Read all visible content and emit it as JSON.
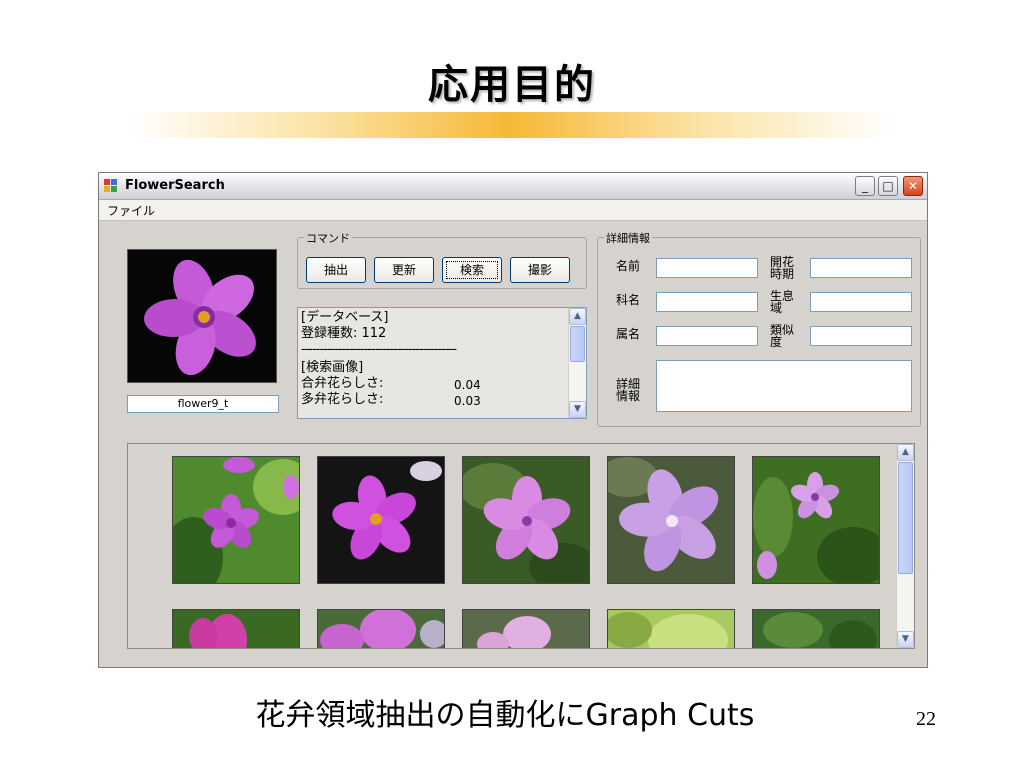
{
  "slide": {
    "title": "応用目的",
    "caption": "花弁領域抽出の自動化にGraph Cuts",
    "page_number": "22"
  },
  "window": {
    "title": "FlowerSearch",
    "menu": {
      "file": "ファイル"
    },
    "buttons": {
      "minimize": "_",
      "maximize": "□",
      "close": "✕"
    }
  },
  "query": {
    "image_label": "flower9_t",
    "image_icon": "flower-image"
  },
  "command": {
    "legend": "コマンド",
    "buttons": {
      "extract": "抽出",
      "update": "更新",
      "search": "検索",
      "capture": "撮影"
    }
  },
  "log": {
    "db_header": "[データベース]",
    "registered": "登録種数: 112",
    "separator": "------------------------------------------",
    "search_header": "[検索画像]",
    "rows": [
      {
        "label": "合弁花らしさ:",
        "value": "0.04"
      },
      {
        "label": "多弁花らしさ:",
        "value": "0.03"
      }
    ]
  },
  "details": {
    "legend": "詳細情報",
    "name_label": "名前",
    "family_label": "科名",
    "genus_label": "属名",
    "bloom_label_1": "開花",
    "bloom_label_2": "時期",
    "habitat_label_1": "生息",
    "habitat_label_2": "域",
    "similarity_label_1": "類似",
    "similarity_label_2": "度",
    "info_label_1": "詳細",
    "info_label_2": "情報",
    "values": {
      "name": "",
      "family": "",
      "genus": "",
      "bloom": "",
      "habitat": "",
      "similarity": "",
      "info": ""
    }
  },
  "colors": {
    "petal": "#c45ad8",
    "petal_light": "#e3a0ef",
    "center": "#e0a020",
    "leaf": "#3f7a2a",
    "title_gradient": "#f7b836"
  },
  "results": {
    "thumbnails": [
      {
        "icon": "flower-thumbnail-1"
      },
      {
        "icon": "flower-thumbnail-2"
      },
      {
        "icon": "flower-thumbnail-3"
      },
      {
        "icon": "flower-thumbnail-4"
      },
      {
        "icon": "flower-thumbnail-5"
      },
      {
        "icon": "flower-thumbnail-6"
      },
      {
        "icon": "flower-thumbnail-7"
      },
      {
        "icon": "flower-thumbnail-8"
      },
      {
        "icon": "flower-thumbnail-9"
      },
      {
        "icon": "flower-thumbnail-10"
      }
    ]
  }
}
